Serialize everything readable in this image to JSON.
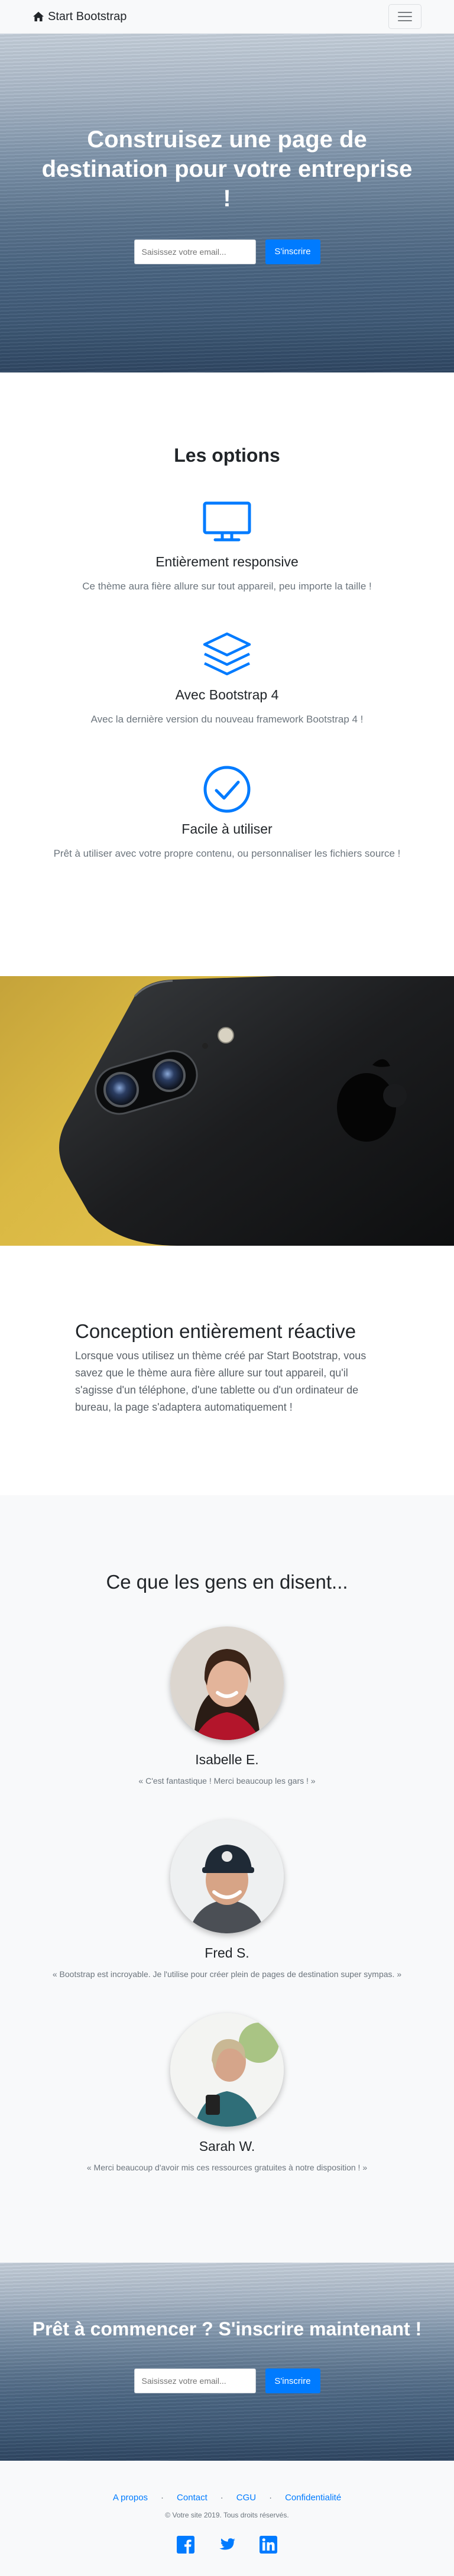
{
  "navbar": {
    "brand": "Start Bootstrap",
    "brand_icon": "home-icon",
    "toggler_icon": "hamburger-icon"
  },
  "hero": {
    "title": "Construisez une page de destination pour votre entreprise !",
    "email_placeholder": "Saisissez votre email...",
    "submit_label": "S'inscrire"
  },
  "options": {
    "title": "Les options",
    "features": [
      {
        "icon": "desktop-monitor-icon",
        "title": "Entièrement responsive",
        "text": "Ce thème aura fière allure sur tout appareil, peu importe la taille !"
      },
      {
        "icon": "layers-icon",
        "title": "Avec Bootstrap 4",
        "text": "Avec la dernière version du nouveau framework Bootstrap 4 !"
      },
      {
        "icon": "check-circle-icon",
        "title": "Facile à utiliser",
        "text": "Prêt à utiliser avec votre propre contenu, ou personnaliser les fichiers source !"
      }
    ]
  },
  "showcase": {
    "title": "Conception entièrement réactive",
    "text": "Lorsque vous utilisez un thème créé par Start Bootstrap, vous savez que le thème aura fière allure sur tout appareil, qu'il s'agisse d'un téléphone, d'une tablette ou d'un ordinateur de bureau, la page s'adaptera automatiquement !"
  },
  "testimonials": {
    "title": "Ce que les gens en disent...",
    "people": [
      {
        "name": "Isabelle E.",
        "quote": "« C'est fantastique ! Merci beaucoup les gars ! »"
      },
      {
        "name": "Fred S.",
        "quote": "« Bootstrap est incroyable. Je l'utilise pour créer plein de pages de destination super sympas. »"
      },
      {
        "name": "Sarah W.",
        "quote": "« Merci beaucoup d'avoir mis ces ressources gratuites à notre disposition ! »"
      }
    ]
  },
  "cta": {
    "title": "Prêt à commencer ? S'inscrire maintenant !",
    "email_placeholder": "Saisissez votre email...",
    "submit_label": "S'inscrire"
  },
  "footer": {
    "links": [
      "A propos",
      "Contact",
      "CGU",
      "Confidentialité"
    ],
    "separator": "·",
    "copyright": "© Votre site 2019. Tous droits réservés.",
    "social_icons": [
      "facebook-icon",
      "twitter-icon",
      "linkedin-icon"
    ]
  },
  "colors": {
    "primary": "#007bff",
    "navbar_bg": "#f8f9fa",
    "text_muted": "#6c757d"
  }
}
